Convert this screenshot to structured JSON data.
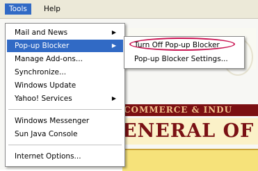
{
  "menubar": {
    "tools_label": "Tools",
    "help_label": "Help"
  },
  "tools_menu": {
    "items": [
      {
        "label": "Mail and News",
        "submenu": true
      },
      {
        "label": "Pop-up Blocker",
        "submenu": true
      },
      {
        "label": "Manage Add-ons...",
        "submenu": false
      },
      {
        "label": "Synchronize...",
        "submenu": false
      },
      {
        "label": "Windows Update",
        "submenu": false
      },
      {
        "label": "Yahoo! Services",
        "submenu": true
      },
      {
        "label": "Windows Messenger",
        "submenu": false
      },
      {
        "label": "Sun Java Console",
        "submenu": false
      },
      {
        "label": "Internet Options...",
        "submenu": false
      }
    ],
    "highlighted": "Pop-up Blocker"
  },
  "popup_submenu": {
    "items": [
      {
        "label": "Turn Off Pop-up Blocker"
      },
      {
        "label": "Pop-up Blocker Settings..."
      }
    ],
    "circled": "Turn Off Pop-up Blocker"
  },
  "background_page": {
    "banner_text": "COMMERCE & INDU",
    "headline_text": "ENERAL OF"
  },
  "colors": {
    "menu_highlight": "#316ac5",
    "annotation_ring": "#c8104f",
    "banner_bg": "#7b0f12",
    "headline_text": "#7a1114"
  }
}
